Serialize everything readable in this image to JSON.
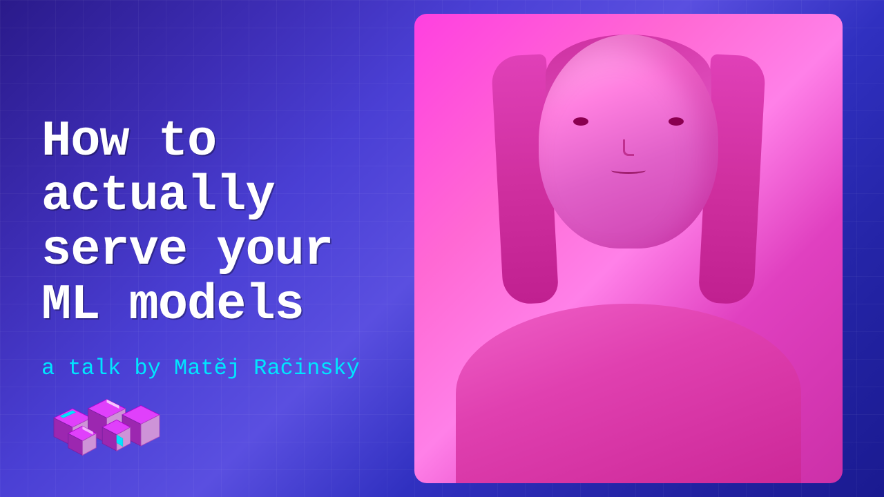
{
  "slide": {
    "title_line1": "How to actually",
    "title_line2": "serve your",
    "title_line3": "ML models",
    "subtitle": "a talk by Matěj Račinský",
    "background_gradient_start": "#2a1a8a",
    "background_gradient_end": "#1a1a90",
    "title_color": "#ffffff",
    "subtitle_color": "#00e5ff",
    "photo_bg_color": "#ff40e0",
    "logo_alt": "PyCon logo"
  }
}
